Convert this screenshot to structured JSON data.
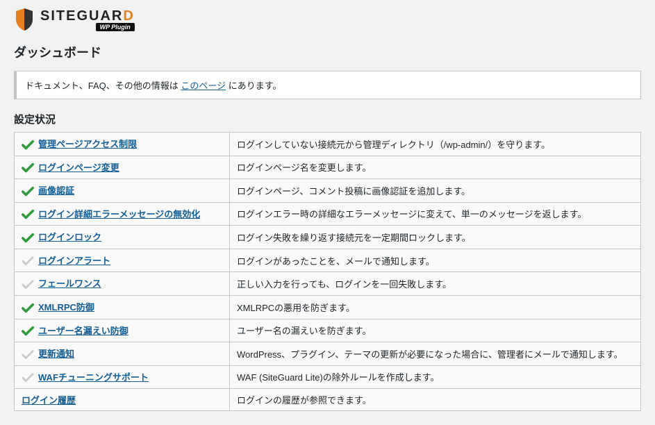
{
  "brand": {
    "name_plain": "SITEGUAR",
    "name_accent": "D",
    "subtitle": "WP Plugin"
  },
  "page_title": "ダッシュボード",
  "notice": {
    "prefix": "ドキュメント、FAQ、その他の情報は ",
    "link": "このページ",
    "suffix": " にあります。"
  },
  "section_title": "設定状況",
  "rows": [
    {
      "enabled": true,
      "label": "管理ページアクセス制限",
      "desc": "ログインしていない接続元から管理ディレクトリ（/wp-admin/）を守ります。"
    },
    {
      "enabled": true,
      "label": "ログインページ変更",
      "desc": "ログインページ名を変更します。"
    },
    {
      "enabled": true,
      "label": "画像認証",
      "desc": "ログインページ、コメント投稿に画像認証を追加します。"
    },
    {
      "enabled": true,
      "label": "ログイン詳細エラーメッセージの無効化",
      "desc": "ログインエラー時の詳細なエラーメッセージに変えて、単一のメッセージを返します。"
    },
    {
      "enabled": true,
      "label": "ログインロック",
      "desc": "ログイン失敗を繰り返す接続元を一定期間ロックします。"
    },
    {
      "enabled": false,
      "label": "ログインアラート",
      "desc": "ログインがあったことを、メールで通知します。"
    },
    {
      "enabled": false,
      "label": "フェールワンス",
      "desc": "正しい入力を行っても、ログインを一回失敗します。"
    },
    {
      "enabled": true,
      "label": "XMLRPC防御",
      "desc": "XMLRPCの悪用を防ぎます。"
    },
    {
      "enabled": true,
      "label": "ユーザー名漏えい防御",
      "desc": "ユーザー名の漏えいを防ぎます。"
    },
    {
      "enabled": false,
      "label": "更新通知",
      "desc": "WordPress、プラグイン、テーマの更新が必要になった場合に、管理者にメールで通知します。"
    },
    {
      "enabled": false,
      "label": "WAFチューニングサポート",
      "desc": "WAF (SiteGuard Lite)の除外ルールを作成します。"
    },
    {
      "enabled": null,
      "label": "ログイン履歴",
      "desc": "ログインの履歴が参照できます。"
    }
  ]
}
